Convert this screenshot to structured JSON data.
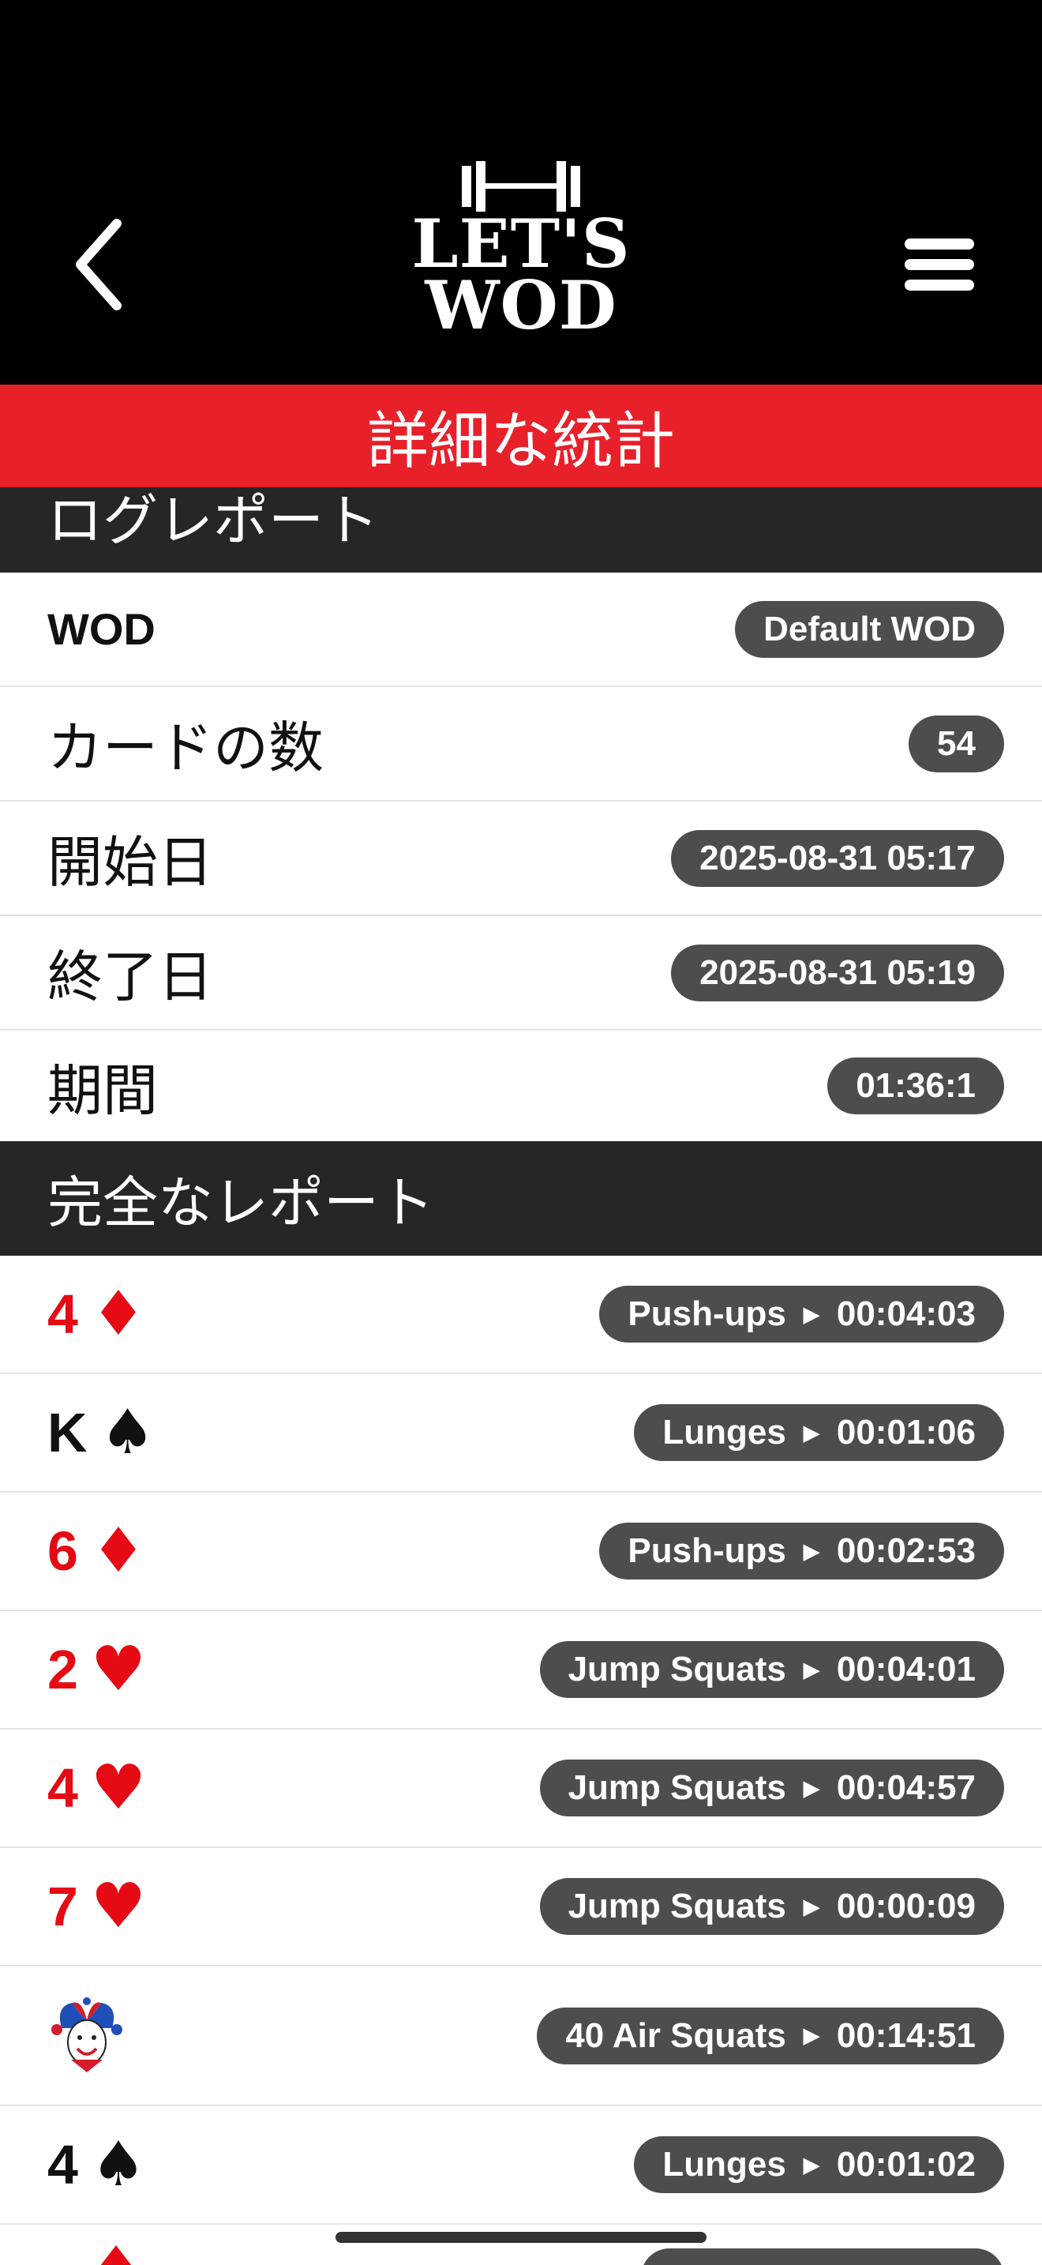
{
  "header": {
    "logo_line1": "LET'S",
    "logo_line2": "WOD",
    "title": "詳細な統計"
  },
  "log_report": {
    "heading": "ログレポート",
    "rows": [
      {
        "label": "WOD",
        "value": "Default WOD"
      },
      {
        "label": "カードの数",
        "value": "54"
      },
      {
        "label": "開始日",
        "value": "2025-08-31 05:17"
      },
      {
        "label": "終了日",
        "value": "2025-08-31 05:19"
      },
      {
        "label": "期間",
        "value": "01:36:1"
      }
    ]
  },
  "full_report": {
    "heading": "完全なレポート",
    "rows": [
      {
        "rank": "4",
        "suit": "♦",
        "color": "red",
        "exercise": "Push-ups",
        "time": "00:04:03"
      },
      {
        "rank": "K",
        "suit": "♠",
        "color": "black",
        "exercise": "Lunges",
        "time": "00:01:06"
      },
      {
        "rank": "6",
        "suit": "♦",
        "color": "red",
        "exercise": "Push-ups",
        "time": "00:02:53"
      },
      {
        "rank": "2",
        "suit": "♥",
        "color": "red",
        "exercise": "Jump Squats",
        "time": "00:04:01"
      },
      {
        "rank": "4",
        "suit": "♥",
        "color": "red",
        "exercise": "Jump Squats",
        "time": "00:04:57"
      },
      {
        "rank": "7",
        "suit": "♥",
        "color": "red",
        "exercise": "Jump Squats",
        "time": "00:00:09"
      },
      {
        "rank": "",
        "suit": "joker",
        "color": "joker",
        "exercise": "40 Air Squats",
        "time": "00:14:51"
      },
      {
        "rank": "4",
        "suit": "♠",
        "color": "black",
        "exercise": "Lunges",
        "time": "00:01:02"
      }
    ]
  },
  "colors": {
    "header_bg": "#000000",
    "title_bar": "#e8202a",
    "section_bg": "#262626",
    "pill_bg": "#4d4d4d",
    "red_suit": "#e50a14"
  },
  "icons": {
    "back": "chevron-left-icon",
    "menu": "hamburger-menu-icon",
    "logo": "barbell-kettlebell-logo",
    "joker": "joker-card-icon"
  }
}
